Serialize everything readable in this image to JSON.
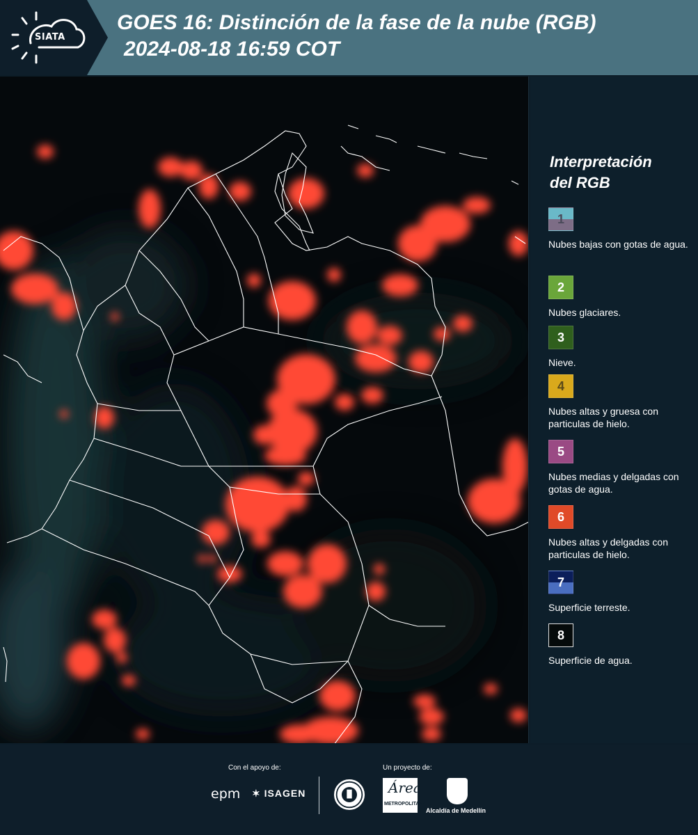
{
  "header": {
    "logo_text": "SIATA",
    "title_line1": "GOES 16: Distinción de la fase de la nube (RGB)",
    "title_line2": "2024-08-18 16:59 COT"
  },
  "legend": {
    "title_line1": "Interpretación",
    "title_line2": "del RGB",
    "items": [
      {
        "number": "1",
        "label": "Nubes bajas con gotas de agua.",
        "color_top": "#6ab9c8",
        "color_bottom": "#7d6d86",
        "text_color": "#4a4a5a"
      },
      {
        "number": "2",
        "label": "Nubes glaciares.",
        "color_top": "#6aa63a",
        "color_bottom": "#6aa63a",
        "text_color": "#ffffff"
      },
      {
        "number": "3",
        "label": "Nieve.",
        "color_top": "#2f5f1d",
        "color_bottom": "#2f5f1d",
        "text_color": "#ffffff"
      },
      {
        "number": "4",
        "label": "Nubes altas y gruesa con particulas de hielo.",
        "color_top": "#d9a91c",
        "color_bottom": "#d9a91c",
        "text_color": "#5a4a1a"
      },
      {
        "number": "5",
        "label": "Nubes medias y delgadas con gotas de agua.",
        "color_top": "#9a4a84",
        "color_bottom": "#9a4a84",
        "text_color": "#ffffff"
      },
      {
        "number": "6",
        "label": "Nubes altas y delgadas con particulas de hielo.",
        "color_top": "#e04a28",
        "color_bottom": "#e04a28",
        "text_color": "#ffffff"
      },
      {
        "number": "7",
        "label": "Superficie terreste.",
        "color_top": "#0b1e5a",
        "color_bottom": "#4a6ec0",
        "text_color": "#ffffff"
      },
      {
        "number": "8",
        "label": "Superficie de agua.",
        "color_top": "#050a0a",
        "color_bottom": "#050a0a",
        "text_color": "#ffffff"
      }
    ]
  },
  "footer": {
    "support_label": "Con el apoyo de:",
    "project_label": "Un proyecto de:",
    "epm": "epm",
    "isagen": "ISAGEN",
    "area_script": "Área",
    "area_text": "METROPOLITANA",
    "alcaldia": "Alcaldía de Medellín"
  },
  "colors": {
    "header_band": "#4a7280",
    "background": "#0d1d28",
    "cloud": "#ff4a35",
    "border_lines": "#ffffff"
  }
}
